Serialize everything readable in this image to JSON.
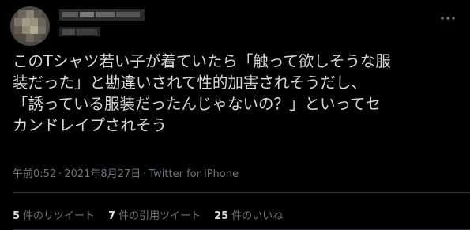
{
  "tweet": {
    "body_lines": [
      "このTシャツ若い子が着ていたら「触って欲しそうな服",
      "装だった」と勘違いされて性的加害されそうだし、",
      "「誘っている服装だったんじゃないの？」といってセ",
      "カンドレイプされそう"
    ],
    "time": "午前0:52",
    "date": "2021年8月27日",
    "source": "Twitter for iPhone",
    "separator": "·"
  },
  "stats": {
    "retweets_count": "5",
    "retweets_label": "件のリツイート",
    "quotes_count": "7",
    "quotes_label": "件の引用ツイート",
    "likes_count": "25",
    "likes_label": "件のいいね"
  },
  "icons": {
    "more": "more-options-icon",
    "avatar": "blurred-avatar"
  },
  "colors": {
    "background": "#000000",
    "text": "#d9d9d9",
    "muted": "#6e767d",
    "divider": "#2f3336"
  }
}
